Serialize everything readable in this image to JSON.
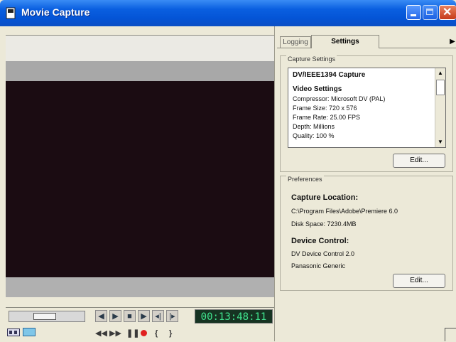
{
  "window": {
    "title": "Movie Capture",
    "buttons": {
      "minimize": "minimize-icon",
      "maximize": "maximize-icon",
      "close": "close-icon"
    }
  },
  "player": {
    "timecode": "00:13:48:11",
    "transport_row1": [
      "step-back-icon",
      "play-icon",
      "stop-icon",
      "play-forward-icon",
      "mark-in-icon",
      "mark-out-icon"
    ],
    "transport_row2": [
      "rewind-icon",
      "fast-forward-icon",
      "pause-icon",
      "record-icon",
      "in-point-icon",
      "out-point-icon"
    ]
  },
  "tabs": [
    {
      "label": "Logging",
      "active": false
    },
    {
      "label": "Settings",
      "active": true
    }
  ],
  "capture_settings": {
    "group_title": "Capture Settings",
    "header": "DV/IEEE1394 Capture",
    "section": "Video Settings",
    "lines": [
      "Compressor: Microsoft DV (PAL)",
      "Frame Size: 720 x 576",
      "Frame Rate: 25.00 FPS",
      "Depth: Millions",
      "Quality: 100 %"
    ],
    "edit_label": "Edit..."
  },
  "preferences": {
    "group_title": "Preferences",
    "capture_location_label": "Capture Location:",
    "capture_path": "C:\\Program Files\\Adobe\\Premiere 6.0",
    "disk_space": "Disk Space: 7230.4MB",
    "device_control_label": "Device Control:",
    "device": "DV Device Control 2.0",
    "device_model": "Panasonic Generic",
    "edit_label": "Edit..."
  },
  "colors": {
    "titlebar": "#0454d6",
    "timecode_bg": "#163322",
    "timecode_fg": "#41e58f",
    "record": "#e02020"
  }
}
